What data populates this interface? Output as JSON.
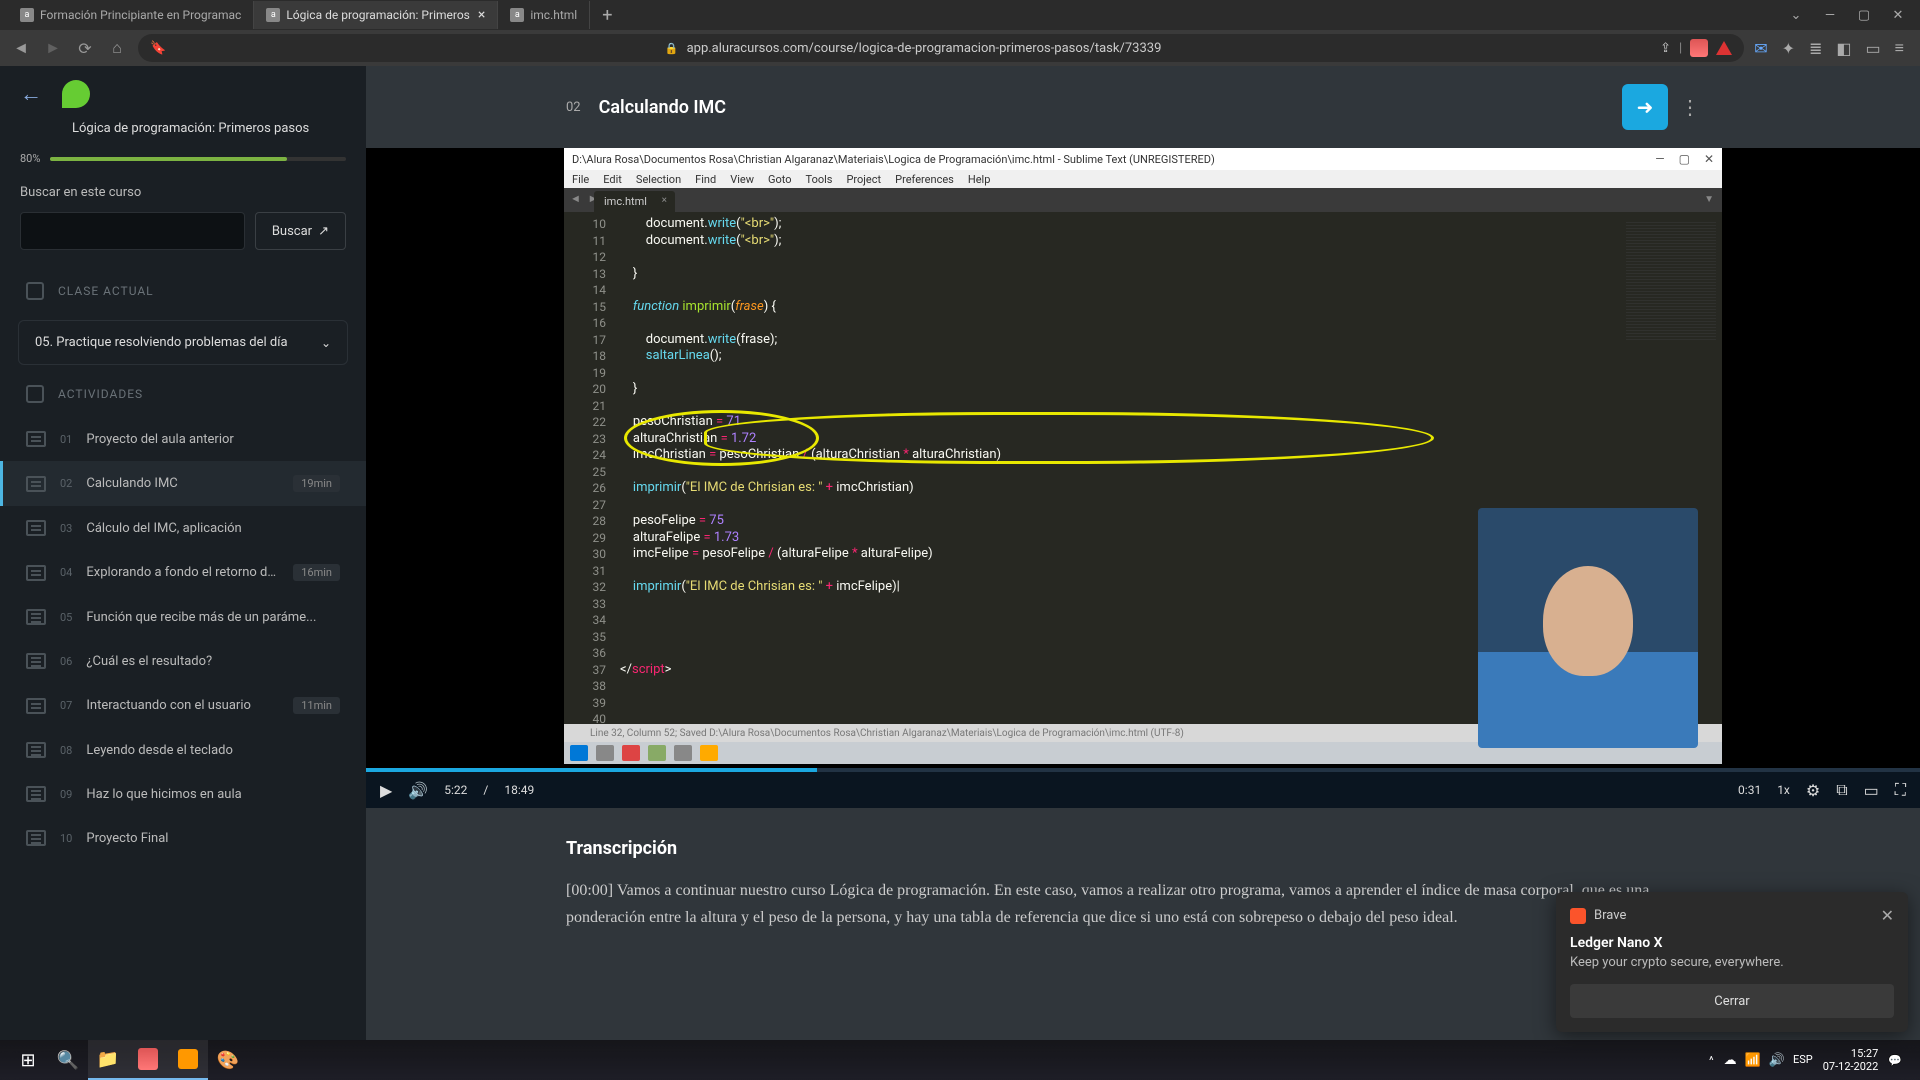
{
  "browser": {
    "tabs": [
      {
        "label": "Formación Principiante en Programac",
        "active": false,
        "closeable": false
      },
      {
        "label": "Lógica de programación: Primeros",
        "active": true,
        "closeable": true
      },
      {
        "label": "imc.html",
        "active": false,
        "closeable": false
      }
    ],
    "url": "app.aluracursos.com/course/logica-de-programacion-primeros-pasos/task/73339"
  },
  "sidebar": {
    "course_title": "Lógica de programación: Primeros pasos",
    "progress_pct": "80%",
    "search_label": "Buscar en este curso",
    "search_btn": "Buscar",
    "section_current": "CLASE ACTUAL",
    "current_lesson": "05. Practique resolviendo problemas del día",
    "section_activities": "ACTIVIDADES",
    "activities": [
      {
        "num": "01",
        "title": "Proyecto del aula anterior",
        "duration": "",
        "icon": "code",
        "active": false
      },
      {
        "num": "02",
        "title": "Calculando IMC",
        "duration": "19min",
        "icon": "code",
        "active": true
      },
      {
        "num": "03",
        "title": "Cálculo del IMC, aplicación",
        "duration": "",
        "icon": "code",
        "active": false
      },
      {
        "num": "04",
        "title": "Explorando a fondo el retorno de...",
        "duration": "16min",
        "icon": "code",
        "active": false
      },
      {
        "num": "05",
        "title": "Función que recibe más de un paráme...",
        "duration": "",
        "icon": "list",
        "active": false
      },
      {
        "num": "06",
        "title": "¿Cuál es el resultado?",
        "duration": "",
        "icon": "list",
        "active": false
      },
      {
        "num": "07",
        "title": "Interactuando con el usuario",
        "duration": "11min",
        "icon": "code",
        "active": false
      },
      {
        "num": "08",
        "title": "Leyendo desde el teclado",
        "duration": "",
        "icon": "list",
        "active": false
      },
      {
        "num": "09",
        "title": "Haz lo que hicimos en aula",
        "duration": "",
        "icon": "list",
        "active": false
      },
      {
        "num": "10",
        "title": "Proyecto Final",
        "duration": "",
        "icon": "list",
        "active": false
      }
    ]
  },
  "lesson": {
    "num": "02",
    "title": "Calculando IMC"
  },
  "editor": {
    "window_title": "D:\\Alura Rosa\\Documentos Rosa\\Christian Algaranaz\\Materiais\\Logica de Programación\\imc.html - Sublime Text (UNREGISTERED)",
    "menus": [
      "File",
      "Edit",
      "Selection",
      "Find",
      "View",
      "Goto",
      "Tools",
      "Project",
      "Preferences",
      "Help"
    ],
    "tab": "imc.html",
    "status": "Line 32, Column 52; Saved D:\\Alura Rosa\\Documentos Rosa\\Christian Algaranaz\\Materiais\\Logica de Programación\\imc.html (UTF-8)",
    "lines": [
      {
        "n": 10,
        "html": "        <span class='c-pl'>document</span><span class='c-pl'>.</span><span class='c-call'>write</span><span class='c-pl'>(</span><span class='c-str'>\"&lt;br&gt;\"</span><span class='c-pl'>);</span>"
      },
      {
        "n": 11,
        "html": "        <span class='c-pl'>document</span><span class='c-pl'>.</span><span class='c-call'>write</span><span class='c-pl'>(</span><span class='c-str'>\"&lt;br&gt;\"</span><span class='c-pl'>);</span>"
      },
      {
        "n": 12,
        "html": ""
      },
      {
        "n": 13,
        "html": "    <span class='c-pl'>}</span>"
      },
      {
        "n": 14,
        "html": ""
      },
      {
        "n": 15,
        "html": "    <span class='c-fn'>function</span> <span class='c-name'>imprimir</span><span class='c-pl'>(</span><span class='c-param'>frase</span><span class='c-pl'>) {</span>"
      },
      {
        "n": 16,
        "html": ""
      },
      {
        "n": 17,
        "html": "        <span class='c-pl'>document</span><span class='c-pl'>.</span><span class='c-call'>write</span><span class='c-pl'>(frase);</span>"
      },
      {
        "n": 18,
        "html": "        <span class='c-call'>saltarLinea</span><span class='c-pl'>();</span>"
      },
      {
        "n": 19,
        "html": ""
      },
      {
        "n": 20,
        "html": "    <span class='c-pl'>}</span>"
      },
      {
        "n": 21,
        "html": ""
      },
      {
        "n": 22,
        "html": "    <span class='c-pl'>pesoChristian </span><span class='c-op'>=</span><span class='c-pl'> </span><span class='c-num'>71</span>"
      },
      {
        "n": 23,
        "html": "    <span class='c-pl'>alturaChristian </span><span class='c-op'>=</span><span class='c-pl'> </span><span class='c-num'>1.72</span>"
      },
      {
        "n": 24,
        "html": "    <span class='c-pl'>imcChristian </span><span class='c-op'>=</span><span class='c-pl'> pesoChristian </span><span class='c-op'>/</span><span class='c-pl'> (alturaChristian </span><span class='c-op'>*</span><span class='c-pl'> alturaChristian)</span>"
      },
      {
        "n": 25,
        "html": ""
      },
      {
        "n": 26,
        "html": "    <span class='c-call'>imprimir</span><span class='c-pl'>(</span><span class='c-str'>\"El IMC de Chrisian es: \"</span><span class='c-pl'> </span><span class='c-op'>+</span><span class='c-pl'> imcChristian)</span>"
      },
      {
        "n": 27,
        "html": ""
      },
      {
        "n": 28,
        "html": "    <span class='c-pl'>pesoFelipe </span><span class='c-op'>=</span><span class='c-pl'> </span><span class='c-num'>75</span>"
      },
      {
        "n": 29,
        "html": "    <span class='c-pl'>alturaFelipe </span><span class='c-op'>=</span><span class='c-pl'> </span><span class='c-num'>1.73</span>"
      },
      {
        "n": 30,
        "html": "    <span class='c-pl'>imcFelipe </span><span class='c-op'>=</span><span class='c-pl'> pesoFelipe </span><span class='c-op'>/</span><span class='c-pl'> (alturaFelipe </span><span class='c-op'>*</span><span class='c-pl'> alturaFelipe)</span>"
      },
      {
        "n": 31,
        "html": ""
      },
      {
        "n": 32,
        "html": "    <span class='c-call'>imprimir</span><span class='c-pl'>(</span><span class='c-str'>\"El IMC de Chrisian es: \"</span><span class='c-pl'> </span><span class='c-op'>+</span><span class='c-pl'> imcFelipe)|</span>"
      },
      {
        "n": 33,
        "html": ""
      },
      {
        "n": 34,
        "html": ""
      },
      {
        "n": 35,
        "html": ""
      },
      {
        "n": 36,
        "html": ""
      },
      {
        "n": 37,
        "html": "<span class='c-pl'>&lt;/</span><span class='c-kw'>script</span><span class='c-pl'>&gt;</span>"
      },
      {
        "n": 38,
        "html": ""
      },
      {
        "n": 39,
        "html": ""
      },
      {
        "n": 40,
        "html": ""
      }
    ]
  },
  "video": {
    "current": "5:22",
    "sep": "/",
    "total": "18:49",
    "speed": "1x",
    "end_time": "0:31"
  },
  "transcript": {
    "heading": "Transcripción",
    "body": "[00:00] Vamos a continuar nuestro curso Lógica de programación. En este caso, vamos a realizar otro programa, vamos a aprender el índice de masa corporal, que es una ponderación entre la altura y el peso de la persona, y hay una tabla de referencia que dice si uno está con sobrepeso o debajo del peso ideal."
  },
  "notification": {
    "app": "Brave",
    "title": "Ledger Nano X",
    "body": "Keep your crypto secure, everywhere.",
    "button": "Cerrar"
  },
  "taskbar": {
    "time": "15:27",
    "date": "07-12-2022"
  }
}
